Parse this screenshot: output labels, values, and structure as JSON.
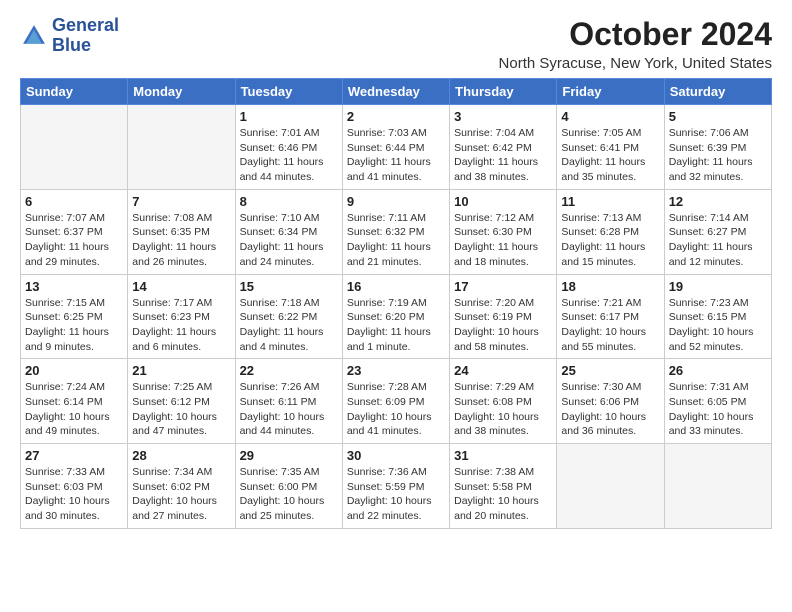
{
  "logo": {
    "line1": "General",
    "line2": "Blue"
  },
  "title": "October 2024",
  "location": "North Syracuse, New York, United States",
  "days_of_week": [
    "Sunday",
    "Monday",
    "Tuesday",
    "Wednesday",
    "Thursday",
    "Friday",
    "Saturday"
  ],
  "weeks": [
    [
      {
        "day": "",
        "empty": true
      },
      {
        "day": "",
        "empty": true
      },
      {
        "day": "1",
        "line1": "Sunrise: 7:01 AM",
        "line2": "Sunset: 6:46 PM",
        "line3": "Daylight: 11 hours",
        "line4": "and 44 minutes."
      },
      {
        "day": "2",
        "line1": "Sunrise: 7:03 AM",
        "line2": "Sunset: 6:44 PM",
        "line3": "Daylight: 11 hours",
        "line4": "and 41 minutes."
      },
      {
        "day": "3",
        "line1": "Sunrise: 7:04 AM",
        "line2": "Sunset: 6:42 PM",
        "line3": "Daylight: 11 hours",
        "line4": "and 38 minutes."
      },
      {
        "day": "4",
        "line1": "Sunrise: 7:05 AM",
        "line2": "Sunset: 6:41 PM",
        "line3": "Daylight: 11 hours",
        "line4": "and 35 minutes."
      },
      {
        "day": "5",
        "line1": "Sunrise: 7:06 AM",
        "line2": "Sunset: 6:39 PM",
        "line3": "Daylight: 11 hours",
        "line4": "and 32 minutes."
      }
    ],
    [
      {
        "day": "6",
        "line1": "Sunrise: 7:07 AM",
        "line2": "Sunset: 6:37 PM",
        "line3": "Daylight: 11 hours",
        "line4": "and 29 minutes."
      },
      {
        "day": "7",
        "line1": "Sunrise: 7:08 AM",
        "line2": "Sunset: 6:35 PM",
        "line3": "Daylight: 11 hours",
        "line4": "and 26 minutes."
      },
      {
        "day": "8",
        "line1": "Sunrise: 7:10 AM",
        "line2": "Sunset: 6:34 PM",
        "line3": "Daylight: 11 hours",
        "line4": "and 24 minutes."
      },
      {
        "day": "9",
        "line1": "Sunrise: 7:11 AM",
        "line2": "Sunset: 6:32 PM",
        "line3": "Daylight: 11 hours",
        "line4": "and 21 minutes."
      },
      {
        "day": "10",
        "line1": "Sunrise: 7:12 AM",
        "line2": "Sunset: 6:30 PM",
        "line3": "Daylight: 11 hours",
        "line4": "and 18 minutes."
      },
      {
        "day": "11",
        "line1": "Sunrise: 7:13 AM",
        "line2": "Sunset: 6:28 PM",
        "line3": "Daylight: 11 hours",
        "line4": "and 15 minutes."
      },
      {
        "day": "12",
        "line1": "Sunrise: 7:14 AM",
        "line2": "Sunset: 6:27 PM",
        "line3": "Daylight: 11 hours",
        "line4": "and 12 minutes."
      }
    ],
    [
      {
        "day": "13",
        "line1": "Sunrise: 7:15 AM",
        "line2": "Sunset: 6:25 PM",
        "line3": "Daylight: 11 hours",
        "line4": "and 9 minutes."
      },
      {
        "day": "14",
        "line1": "Sunrise: 7:17 AM",
        "line2": "Sunset: 6:23 PM",
        "line3": "Daylight: 11 hours",
        "line4": "and 6 minutes."
      },
      {
        "day": "15",
        "line1": "Sunrise: 7:18 AM",
        "line2": "Sunset: 6:22 PM",
        "line3": "Daylight: 11 hours",
        "line4": "and 4 minutes."
      },
      {
        "day": "16",
        "line1": "Sunrise: 7:19 AM",
        "line2": "Sunset: 6:20 PM",
        "line3": "Daylight: 11 hours",
        "line4": "and 1 minute."
      },
      {
        "day": "17",
        "line1": "Sunrise: 7:20 AM",
        "line2": "Sunset: 6:19 PM",
        "line3": "Daylight: 10 hours",
        "line4": "and 58 minutes."
      },
      {
        "day": "18",
        "line1": "Sunrise: 7:21 AM",
        "line2": "Sunset: 6:17 PM",
        "line3": "Daylight: 10 hours",
        "line4": "and 55 minutes."
      },
      {
        "day": "19",
        "line1": "Sunrise: 7:23 AM",
        "line2": "Sunset: 6:15 PM",
        "line3": "Daylight: 10 hours",
        "line4": "and 52 minutes."
      }
    ],
    [
      {
        "day": "20",
        "line1": "Sunrise: 7:24 AM",
        "line2": "Sunset: 6:14 PM",
        "line3": "Daylight: 10 hours",
        "line4": "and 49 minutes."
      },
      {
        "day": "21",
        "line1": "Sunrise: 7:25 AM",
        "line2": "Sunset: 6:12 PM",
        "line3": "Daylight: 10 hours",
        "line4": "and 47 minutes."
      },
      {
        "day": "22",
        "line1": "Sunrise: 7:26 AM",
        "line2": "Sunset: 6:11 PM",
        "line3": "Daylight: 10 hours",
        "line4": "and 44 minutes."
      },
      {
        "day": "23",
        "line1": "Sunrise: 7:28 AM",
        "line2": "Sunset: 6:09 PM",
        "line3": "Daylight: 10 hours",
        "line4": "and 41 minutes."
      },
      {
        "day": "24",
        "line1": "Sunrise: 7:29 AM",
        "line2": "Sunset: 6:08 PM",
        "line3": "Daylight: 10 hours",
        "line4": "and 38 minutes."
      },
      {
        "day": "25",
        "line1": "Sunrise: 7:30 AM",
        "line2": "Sunset: 6:06 PM",
        "line3": "Daylight: 10 hours",
        "line4": "and 36 minutes."
      },
      {
        "day": "26",
        "line1": "Sunrise: 7:31 AM",
        "line2": "Sunset: 6:05 PM",
        "line3": "Daylight: 10 hours",
        "line4": "and 33 minutes."
      }
    ],
    [
      {
        "day": "27",
        "line1": "Sunrise: 7:33 AM",
        "line2": "Sunset: 6:03 PM",
        "line3": "Daylight: 10 hours",
        "line4": "and 30 minutes."
      },
      {
        "day": "28",
        "line1": "Sunrise: 7:34 AM",
        "line2": "Sunset: 6:02 PM",
        "line3": "Daylight: 10 hours",
        "line4": "and 27 minutes."
      },
      {
        "day": "29",
        "line1": "Sunrise: 7:35 AM",
        "line2": "Sunset: 6:00 PM",
        "line3": "Daylight: 10 hours",
        "line4": "and 25 minutes."
      },
      {
        "day": "30",
        "line1": "Sunrise: 7:36 AM",
        "line2": "Sunset: 5:59 PM",
        "line3": "Daylight: 10 hours",
        "line4": "and 22 minutes."
      },
      {
        "day": "31",
        "line1": "Sunrise: 7:38 AM",
        "line2": "Sunset: 5:58 PM",
        "line3": "Daylight: 10 hours",
        "line4": "and 20 minutes."
      },
      {
        "day": "",
        "empty": true
      },
      {
        "day": "",
        "empty": true
      }
    ]
  ]
}
